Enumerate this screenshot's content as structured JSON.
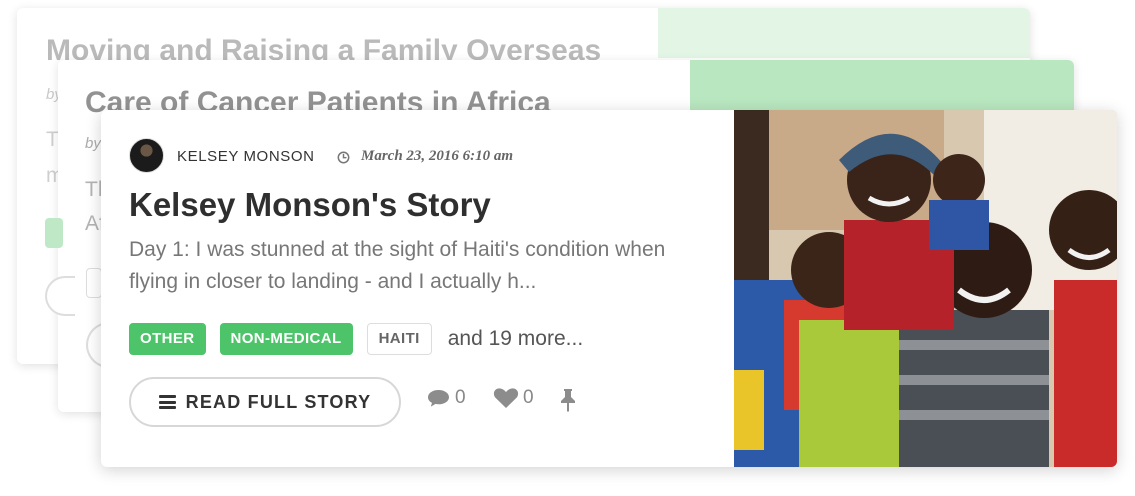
{
  "back_cards": [
    {
      "title": "Moving and Raising a Family Overseas",
      "byline": "by",
      "excerpt_fragments": [
        "T",
        "m"
      ]
    },
    {
      "title": "Care of Cancer Patients in Africa",
      "byline": "by",
      "excerpt_fragments": [
        "Th",
        "Af"
      ]
    }
  ],
  "story": {
    "author": "KELSEY MONSON",
    "date": "March 23, 2016 6:10 am",
    "title": "Kelsey Monson's Story",
    "excerpt": "Day 1: I was stunned at the sight of Haiti's condition when flying in closer to landing - and I actually h...",
    "tags": [
      {
        "label": "OTHER",
        "style": "filled"
      },
      {
        "label": "NON-MEDICAL",
        "style": "filled"
      },
      {
        "label": "HAITI",
        "style": "outline"
      }
    ],
    "more_tags": "and 19 more...",
    "read_button": "READ FULL STORY",
    "comments": "0",
    "likes": "0"
  },
  "icons": {
    "clock": "clock-icon",
    "menu": "menu-icon",
    "comment": "comment-icon",
    "heart": "heart-icon",
    "pin": "pin-icon"
  },
  "colors": {
    "tag_green": "#4ec46a",
    "back_card_strip_1": "#e3f6e6",
    "back_card_strip_2": "#b9e7c0"
  }
}
